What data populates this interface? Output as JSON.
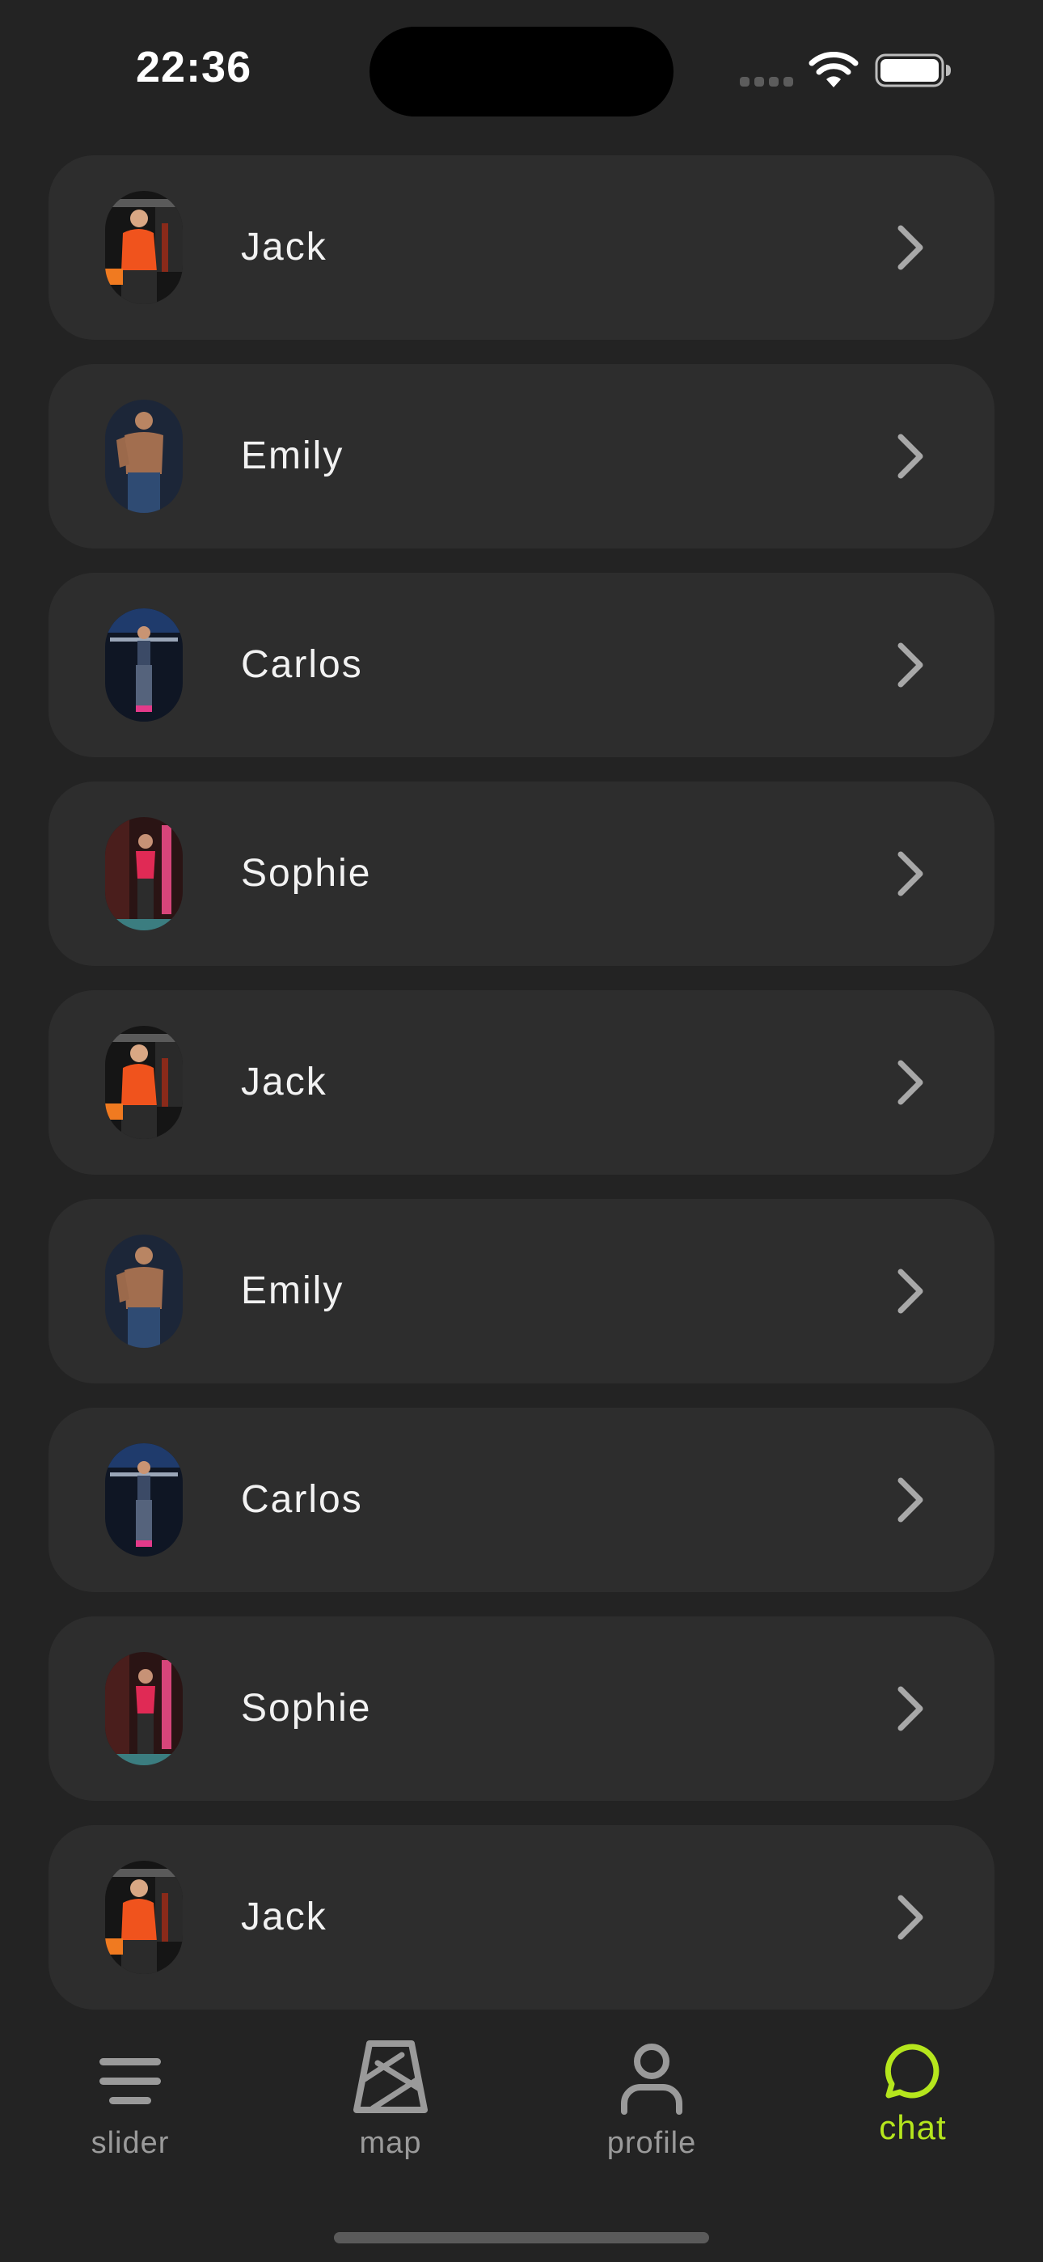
{
  "status_bar": {
    "time": "22:36"
  },
  "contacts": [
    {
      "name": "Jack",
      "avatar": "photo-orange-shirt"
    },
    {
      "name": "Emily",
      "avatar": "photo-shirtless-blue"
    },
    {
      "name": "Carlos",
      "avatar": "photo-barbell-blue"
    },
    {
      "name": "Sophie",
      "avatar": "photo-pink-top"
    },
    {
      "name": "Jack",
      "avatar": "photo-orange-shirt"
    },
    {
      "name": "Emily",
      "avatar": "photo-shirtless-blue"
    },
    {
      "name": "Carlos",
      "avatar": "photo-barbell-blue"
    },
    {
      "name": "Sophie",
      "avatar": "photo-pink-top"
    },
    {
      "name": "Jack",
      "avatar": "photo-orange-shirt"
    }
  ],
  "tabs": [
    {
      "label": "slider",
      "icon": "menu-lines-icon",
      "active": false
    },
    {
      "label": "map",
      "icon": "map-icon",
      "active": false
    },
    {
      "label": "profile",
      "icon": "person-icon",
      "active": false
    },
    {
      "label": "chat",
      "icon": "chat-bubble-icon",
      "active": true
    }
  ],
  "colors": {
    "background": "#232323",
    "card": "#2d2d2d",
    "accent": "#b5e61d",
    "inactive": "#9a9a9a"
  }
}
